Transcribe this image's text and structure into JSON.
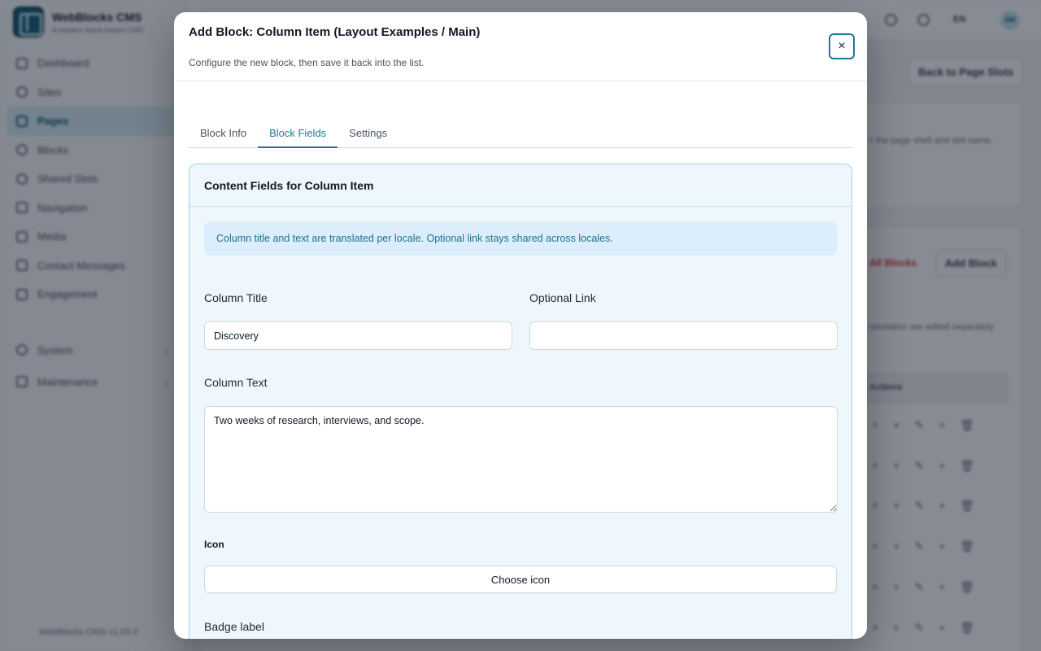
{
  "app": {
    "brand_title": "WebBlocks CMS",
    "brand_subtitle": "A modern block-based CMS",
    "version": "WebBlocks CMS v1.55.0",
    "language": "EN",
    "avatar_initials": "AW"
  },
  "sidebar": {
    "items": [
      {
        "label": "Dashboard"
      },
      {
        "label": "Sites"
      },
      {
        "label": "Pages"
      },
      {
        "label": "Blocks"
      },
      {
        "label": "Shared Slots"
      },
      {
        "label": "Navigation"
      },
      {
        "label": "Media"
      },
      {
        "label": "Contact Messages"
      },
      {
        "label": "Engagement"
      }
    ],
    "groups": [
      {
        "label": "System"
      },
      {
        "label": "Maintenance"
      }
    ]
  },
  "background": {
    "back_button": "Back to Page Slots",
    "hint_text": "n the page shell and slot name.",
    "all_blocks": "All Blocks",
    "add_block": "Add Block",
    "translation_note": "ranslation are edited separately.",
    "actions_header": "Actions"
  },
  "modal": {
    "title": "Add Block: Column Item (Layout Examples / Main)",
    "subtitle": "Configure the new block, then save it back into the list.",
    "close_label": "×",
    "tabs": [
      {
        "label": "Block Info"
      },
      {
        "label": "Block Fields"
      },
      {
        "label": "Settings"
      }
    ],
    "active_tab": "Block Fields",
    "panel_title": "Content Fields for Column Item",
    "note": "Column title and text are translated per locale. Optional link stays shared across locales.",
    "fields": {
      "column_title": {
        "label": "Column Title",
        "value": "Discovery"
      },
      "optional_link": {
        "label": "Optional Link",
        "value": ""
      },
      "column_text": {
        "label": "Column Text",
        "value": "Two weeks of research, interviews, and scope."
      },
      "icon": {
        "label": "Icon",
        "button": "Choose icon"
      },
      "badge_label": {
        "label": "Badge label"
      }
    }
  }
}
